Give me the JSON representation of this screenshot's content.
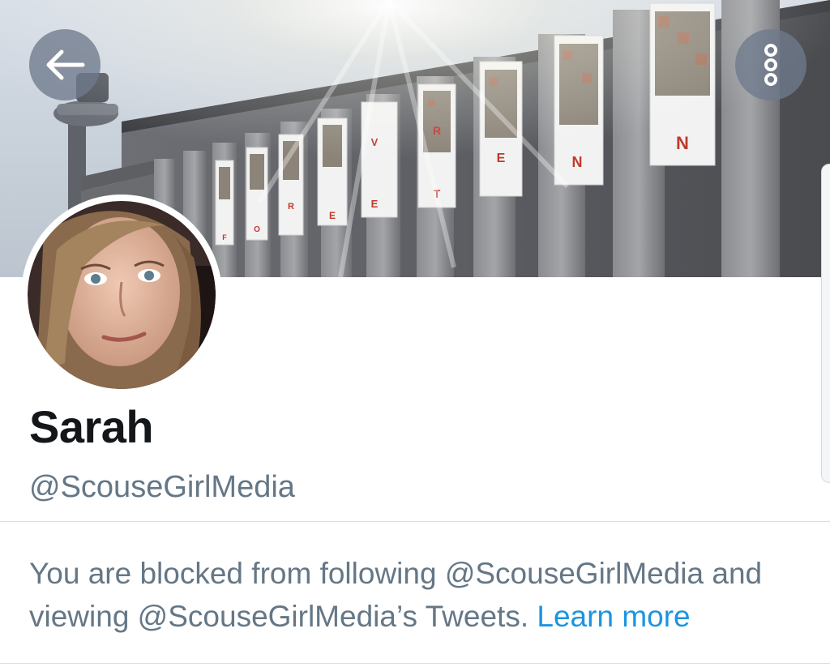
{
  "profile": {
    "display_name": "Sarah",
    "handle": "@ScouseGirlMedia"
  },
  "notice": {
    "text": "You are blocked from following @ScouseGirlMedia and viewing @ScouseGirlMedia’s Tweets.",
    "link_label": "Learn more"
  },
  "banner": {
    "banner_letters": [
      "F",
      "O",
      "R",
      "E",
      "V",
      "E",
      "R",
      "T",
      "E",
      "N"
    ]
  },
  "icons": {
    "back": "arrow-left-icon",
    "more": "more-vertical-icon"
  },
  "colors": {
    "text_primary": "#14171a",
    "text_secondary": "#657786",
    "link": "#1b95e0",
    "divider": "#d9dde1",
    "banner_letter": "#c0392b"
  }
}
